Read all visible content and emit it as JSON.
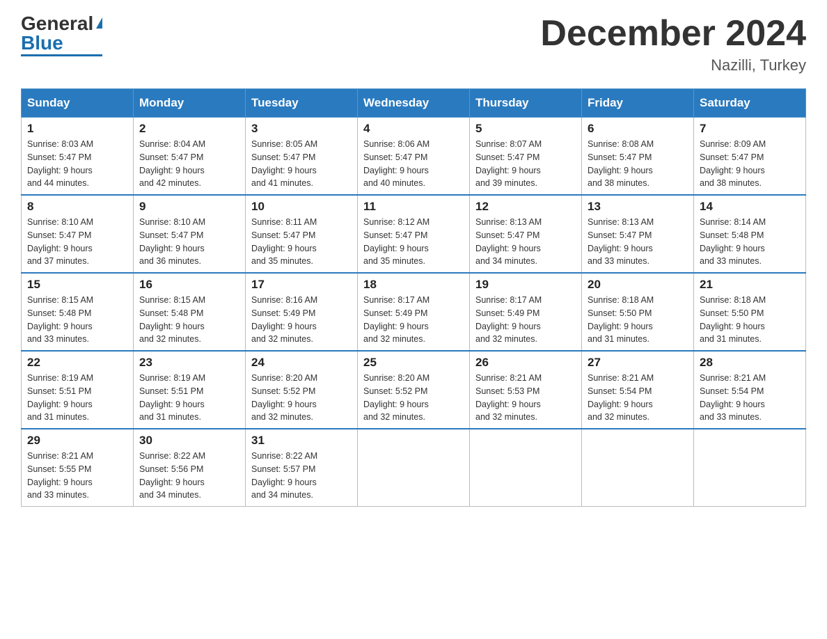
{
  "header": {
    "logo_general": "General",
    "logo_blue": "Blue",
    "main_title": "December 2024",
    "subtitle": "Nazilli, Turkey"
  },
  "calendar": {
    "days_of_week": [
      "Sunday",
      "Monday",
      "Tuesday",
      "Wednesday",
      "Thursday",
      "Friday",
      "Saturday"
    ],
    "weeks": [
      [
        {
          "day": "1",
          "sunrise": "8:03 AM",
          "sunset": "5:47 PM",
          "daylight": "9 hours and 44 minutes."
        },
        {
          "day": "2",
          "sunrise": "8:04 AM",
          "sunset": "5:47 PM",
          "daylight": "9 hours and 42 minutes."
        },
        {
          "day": "3",
          "sunrise": "8:05 AM",
          "sunset": "5:47 PM",
          "daylight": "9 hours and 41 minutes."
        },
        {
          "day": "4",
          "sunrise": "8:06 AM",
          "sunset": "5:47 PM",
          "daylight": "9 hours and 40 minutes."
        },
        {
          "day": "5",
          "sunrise": "8:07 AM",
          "sunset": "5:47 PM",
          "daylight": "9 hours and 39 minutes."
        },
        {
          "day": "6",
          "sunrise": "8:08 AM",
          "sunset": "5:47 PM",
          "daylight": "9 hours and 38 minutes."
        },
        {
          "day": "7",
          "sunrise": "8:09 AM",
          "sunset": "5:47 PM",
          "daylight": "9 hours and 38 minutes."
        }
      ],
      [
        {
          "day": "8",
          "sunrise": "8:10 AM",
          "sunset": "5:47 PM",
          "daylight": "9 hours and 37 minutes."
        },
        {
          "day": "9",
          "sunrise": "8:10 AM",
          "sunset": "5:47 PM",
          "daylight": "9 hours and 36 minutes."
        },
        {
          "day": "10",
          "sunrise": "8:11 AM",
          "sunset": "5:47 PM",
          "daylight": "9 hours and 35 minutes."
        },
        {
          "day": "11",
          "sunrise": "8:12 AM",
          "sunset": "5:47 PM",
          "daylight": "9 hours and 35 minutes."
        },
        {
          "day": "12",
          "sunrise": "8:13 AM",
          "sunset": "5:47 PM",
          "daylight": "9 hours and 34 minutes."
        },
        {
          "day": "13",
          "sunrise": "8:13 AM",
          "sunset": "5:47 PM",
          "daylight": "9 hours and 33 minutes."
        },
        {
          "day": "14",
          "sunrise": "8:14 AM",
          "sunset": "5:48 PM",
          "daylight": "9 hours and 33 minutes."
        }
      ],
      [
        {
          "day": "15",
          "sunrise": "8:15 AM",
          "sunset": "5:48 PM",
          "daylight": "9 hours and 33 minutes."
        },
        {
          "day": "16",
          "sunrise": "8:15 AM",
          "sunset": "5:48 PM",
          "daylight": "9 hours and 32 minutes."
        },
        {
          "day": "17",
          "sunrise": "8:16 AM",
          "sunset": "5:49 PM",
          "daylight": "9 hours and 32 minutes."
        },
        {
          "day": "18",
          "sunrise": "8:17 AM",
          "sunset": "5:49 PM",
          "daylight": "9 hours and 32 minutes."
        },
        {
          "day": "19",
          "sunrise": "8:17 AM",
          "sunset": "5:49 PM",
          "daylight": "9 hours and 32 minutes."
        },
        {
          "day": "20",
          "sunrise": "8:18 AM",
          "sunset": "5:50 PM",
          "daylight": "9 hours and 31 minutes."
        },
        {
          "day": "21",
          "sunrise": "8:18 AM",
          "sunset": "5:50 PM",
          "daylight": "9 hours and 31 minutes."
        }
      ],
      [
        {
          "day": "22",
          "sunrise": "8:19 AM",
          "sunset": "5:51 PM",
          "daylight": "9 hours and 31 minutes."
        },
        {
          "day": "23",
          "sunrise": "8:19 AM",
          "sunset": "5:51 PM",
          "daylight": "9 hours and 31 minutes."
        },
        {
          "day": "24",
          "sunrise": "8:20 AM",
          "sunset": "5:52 PM",
          "daylight": "9 hours and 32 minutes."
        },
        {
          "day": "25",
          "sunrise": "8:20 AM",
          "sunset": "5:52 PM",
          "daylight": "9 hours and 32 minutes."
        },
        {
          "day": "26",
          "sunrise": "8:21 AM",
          "sunset": "5:53 PM",
          "daylight": "9 hours and 32 minutes."
        },
        {
          "day": "27",
          "sunrise": "8:21 AM",
          "sunset": "5:54 PM",
          "daylight": "9 hours and 32 minutes."
        },
        {
          "day": "28",
          "sunrise": "8:21 AM",
          "sunset": "5:54 PM",
          "daylight": "9 hours and 33 minutes."
        }
      ],
      [
        {
          "day": "29",
          "sunrise": "8:21 AM",
          "sunset": "5:55 PM",
          "daylight": "9 hours and 33 minutes."
        },
        {
          "day": "30",
          "sunrise": "8:22 AM",
          "sunset": "5:56 PM",
          "daylight": "9 hours and 34 minutes."
        },
        {
          "day": "31",
          "sunrise": "8:22 AM",
          "sunset": "5:57 PM",
          "daylight": "9 hours and 34 minutes."
        },
        null,
        null,
        null,
        null
      ]
    ],
    "labels": {
      "sunrise": "Sunrise:",
      "sunset": "Sunset:",
      "daylight": "Daylight:"
    }
  }
}
